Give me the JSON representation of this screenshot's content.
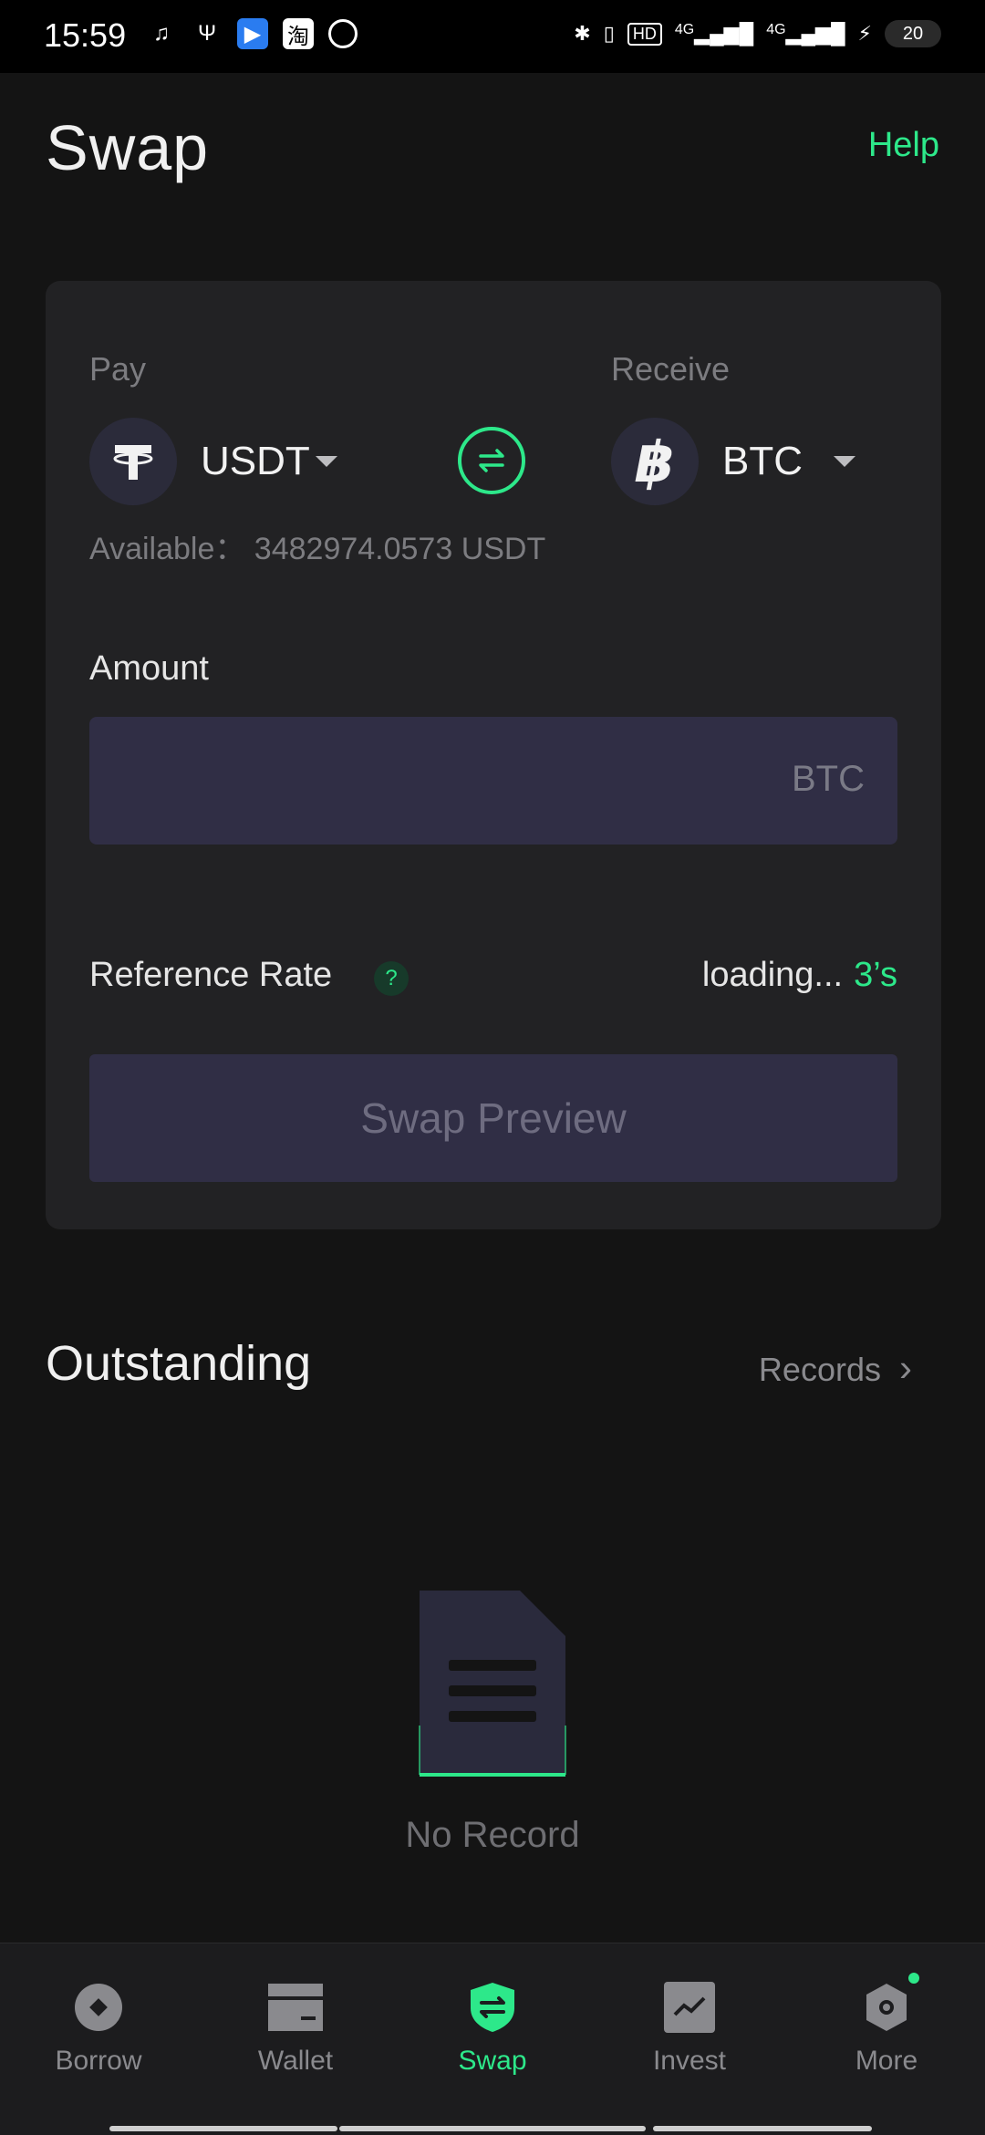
{
  "status_bar": {
    "time": "15:59",
    "left_icons": [
      "listen-icon",
      "usb-icon",
      "app-icon",
      "taobao-icon",
      "quark-icon"
    ],
    "right_icons": [
      "bluetooth-icon",
      "vibrate-icon",
      "hd-icon",
      "signal-4g-1-icon",
      "signal-4g-2-icon",
      "charging-icon"
    ],
    "hd_label": "HD",
    "net_label_1": "4G",
    "net_label_2": "4G",
    "battery": "20"
  },
  "header": {
    "title": "Swap",
    "help": "Help"
  },
  "swap_card": {
    "pay_label": "Pay",
    "receive_label": "Receive",
    "pay_coin": "USDT",
    "receive_coin": "BTC",
    "available": "Available：  3482974.0573 USDT",
    "amount_label": "Amount",
    "amount_value": "",
    "amount_unit": "BTC",
    "rate_label": "Reference Rate",
    "rate_help": "?",
    "rate_status": "loading...",
    "rate_countdown": "3’s",
    "preview_button": "Swap Preview"
  },
  "outstanding": {
    "title": "Outstanding",
    "records": "Records",
    "records_chevron": "›",
    "empty_text": "No Record"
  },
  "bottom_nav": {
    "items": [
      {
        "label": "Borrow",
        "icon": "borrow-icon"
      },
      {
        "label": "Wallet",
        "icon": "wallet-icon"
      },
      {
        "label": "Swap",
        "icon": "swap-icon",
        "active": true
      },
      {
        "label": "Invest",
        "icon": "invest-icon"
      },
      {
        "label": "More",
        "icon": "gear-icon",
        "badge": true
      }
    ]
  },
  "colors": {
    "accent": "#2de88a",
    "background": "#141414",
    "card": "#222224",
    "input": "#302e45"
  }
}
